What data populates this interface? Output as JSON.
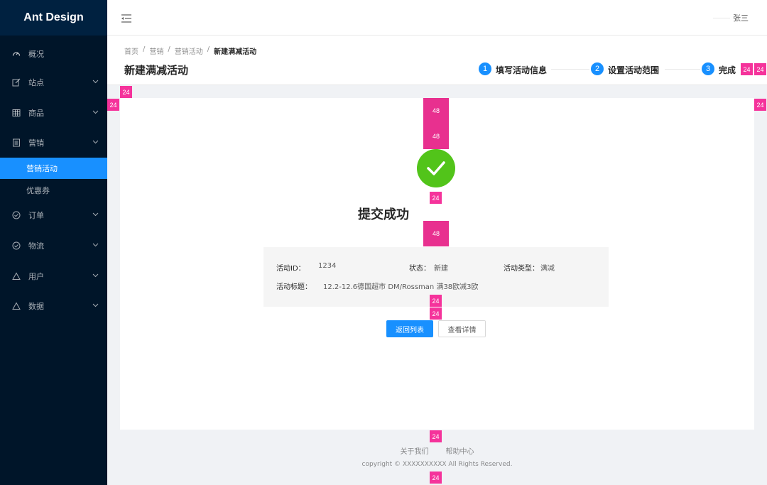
{
  "sidebar": {
    "logo": "Ant Design",
    "items": [
      {
        "label": "概况",
        "icon": "dashboard-icon"
      },
      {
        "label": "站点",
        "icon": "edit-icon"
      },
      {
        "label": "商品",
        "icon": "table-icon"
      },
      {
        "label": "营销",
        "icon": "profile-icon"
      },
      {
        "label": "订单",
        "icon": "check-circle-icon"
      },
      {
        "label": "物流",
        "icon": "check-circle-icon"
      },
      {
        "label": "用户",
        "icon": "warning-icon"
      },
      {
        "label": "数据",
        "icon": "warning-icon"
      }
    ],
    "sub_items": [
      {
        "label": "营销活动",
        "active": true
      },
      {
        "label": "优惠券",
        "active": false
      }
    ]
  },
  "header": {
    "user_name": "张三"
  },
  "breadcrumb": {
    "items": [
      "首页",
      "营销",
      "营销活动",
      "新建满减活动"
    ],
    "separator": "/"
  },
  "page": {
    "title": "新建满减活动"
  },
  "steps": [
    {
      "number": "1",
      "label": "填写活动信息"
    },
    {
      "number": "2",
      "label": "设置活动范围"
    },
    {
      "number": "3",
      "label": "完成"
    }
  ],
  "result": {
    "title": "提交成功",
    "info": {
      "id_label": "活动ID：",
      "id_value": "1234",
      "status_label": "状态：",
      "status_value": "新建",
      "type_label": "活动类型：",
      "type_value": "满减",
      "title_label": "活动标题：",
      "title_value": "12.2-12.6德国超市 DM/Rossman 满38欧减3欧"
    },
    "primary_button": "返回列表",
    "secondary_button": "查看详情"
  },
  "footer": {
    "links": [
      "关于我们",
      "帮助中心"
    ],
    "copyright": "copyright  ©  XXXXXXXXXX All Rights Reserved."
  },
  "spacing_markers": {
    "m24": "24",
    "m48": "48"
  },
  "colors": {
    "sidebar_bg": "#001529",
    "primary": "#1890ff",
    "success": "#52c41a",
    "marker": "#f5339b"
  }
}
